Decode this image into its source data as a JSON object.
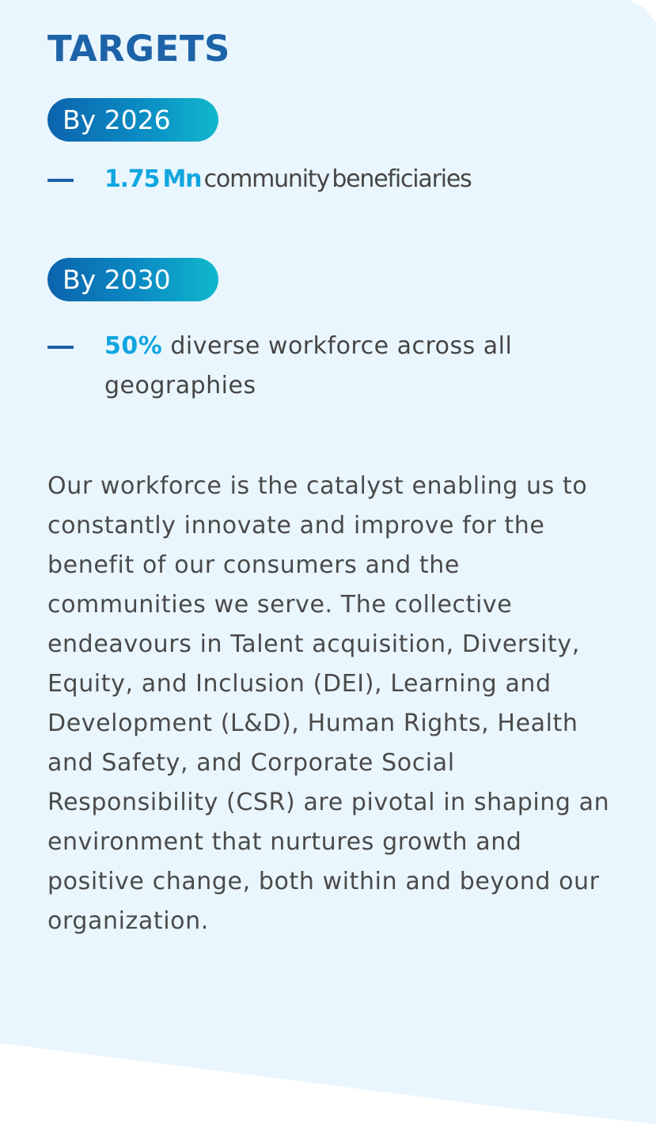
{
  "title": "TARGETS",
  "targets": [
    {
      "label": "By 2026",
      "highlight": "1.75 Mn",
      "text": "community beneficiaries"
    },
    {
      "label": "By 2030",
      "highlight": "50%",
      "text": "diverse workforce across all geographies"
    }
  ],
  "body": "Our workforce is the catalyst enabling us to constantly innovate and improve for the benefit of our consumers and the communities we serve. The collective endeavours in Talent acquisition, Diversity, Equity, and Inclusion (DEI), Learning and Development (L&D), Human Rights, Health and Safety, and Corporate Social Responsibility (CSR) are pivotal in shaping an environment that nurtures growth and positive change, both within and beyond our organization.",
  "colors": {
    "panel_background": "#eaf6fd",
    "title": "#1d63a8",
    "highlight": "#0fa6e0",
    "pill_gradient_start": "#0b63ad",
    "pill_gradient_end": "#10b8cc",
    "body_text": "#4a4a4a"
  }
}
